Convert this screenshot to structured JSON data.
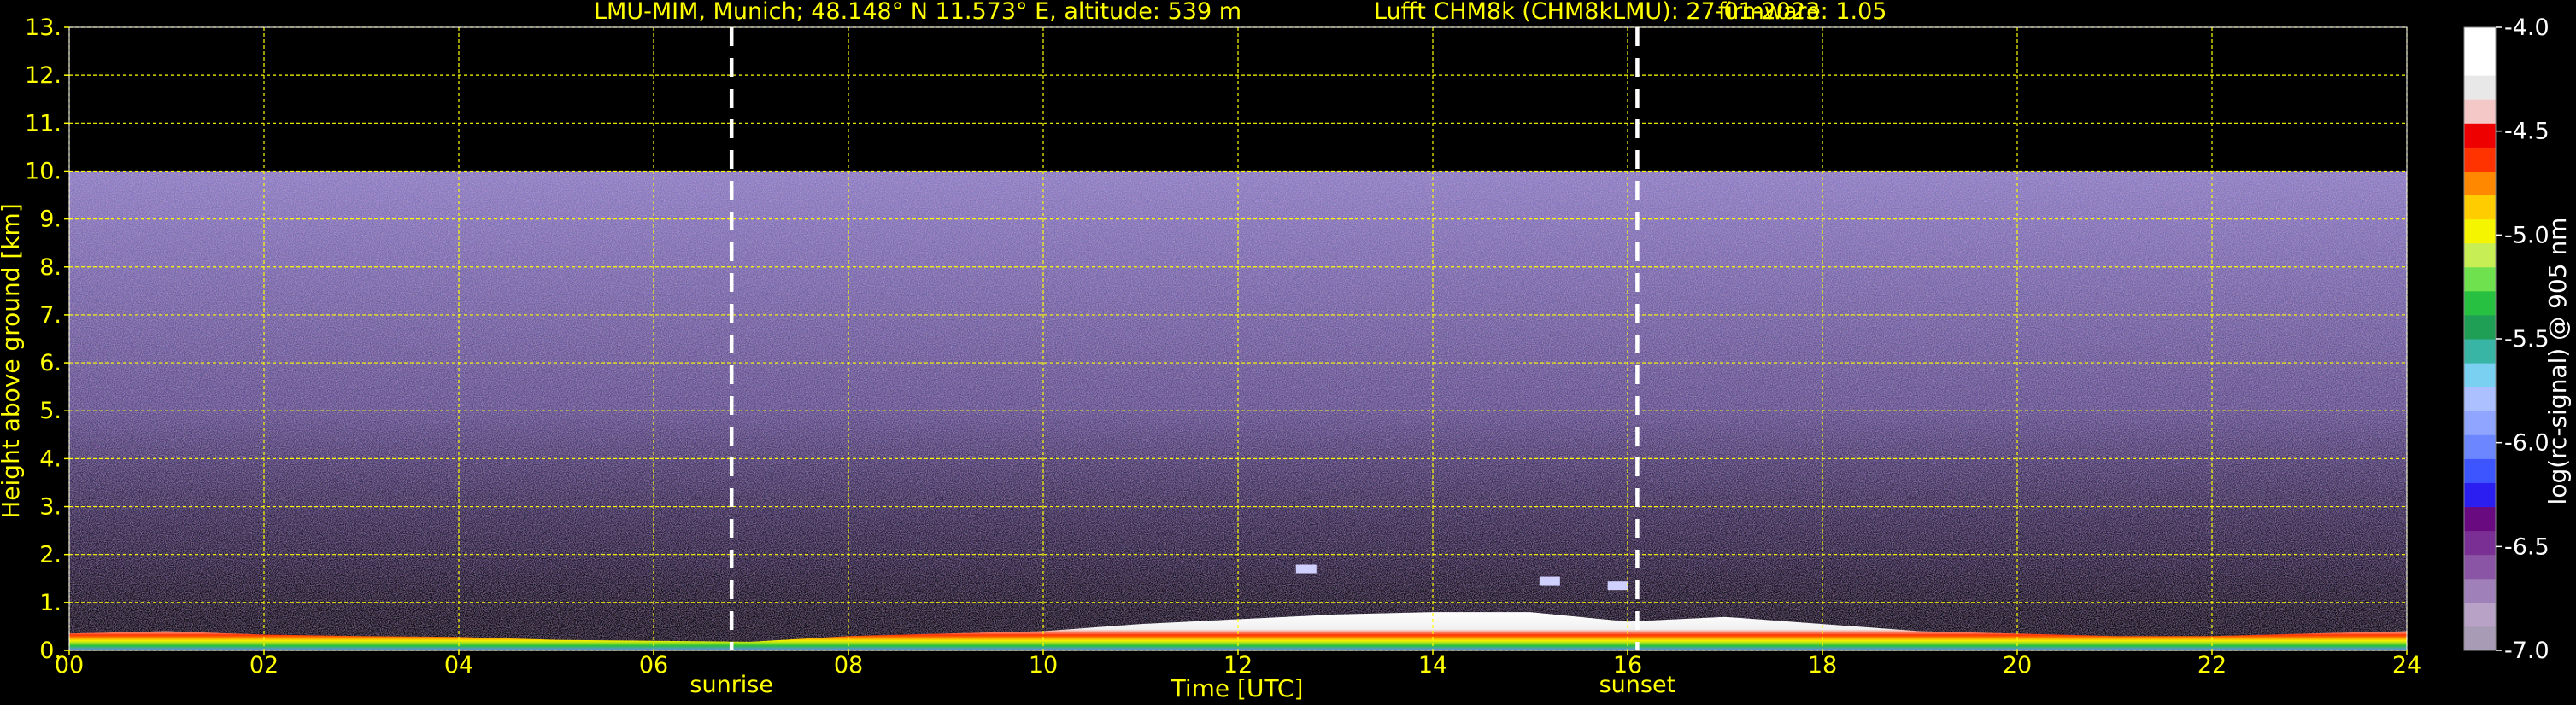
{
  "header": {
    "site": "LMU-MIM, Munich; 48.148° N 11.573° E, altitude: 539 m",
    "instrument": "Lufft CHM8k (CHM8kLMU): 27-01-2023",
    "firmware": "firmware: 1.05"
  },
  "chart_data": {
    "type": "heatmap",
    "xlabel": "Time [UTC]",
    "ylabel": "Height above ground [km]",
    "x_ticks": [
      "00",
      "02",
      "04",
      "06",
      "08",
      "10",
      "12",
      "14",
      "16",
      "18",
      "20",
      "22",
      "24"
    ],
    "y_ticks": [
      "0.",
      "1.",
      "2.",
      "3.",
      "4.",
      "5.",
      "6.",
      "7.",
      "8.",
      "9.",
      "10.",
      "11.",
      "12.",
      "13."
    ],
    "xlim": [
      0,
      24
    ],
    "ylim": [
      0,
      13
    ],
    "grid": true,
    "grid_color": "#ffff00",
    "text_color": "#ffff00",
    "background": "#000000",
    "signal_top_km": 10.0,
    "events": [
      {
        "label": "sunrise",
        "time_utc": 6.8
      },
      {
        "label": "sunset",
        "time_utc": 16.1
      }
    ],
    "colorbar": {
      "label": "log(rc-signal) @ 905 nm",
      "ticks": [
        "-4.0",
        "-4.5",
        "-5.0",
        "-5.5",
        "-6.0",
        "-6.5",
        "-7.0"
      ],
      "range": [
        -7.0,
        -4.0
      ],
      "colors": [
        "#a79bb6",
        "#b8a3c6",
        "#a080b8",
        "#8b55a5",
        "#7a2f95",
        "#6a0a80",
        "#2a1ff0",
        "#3d55ff",
        "#6b86ff",
        "#8fa5ff",
        "#acc0ff",
        "#7ad0f0",
        "#39b5a5",
        "#1f9e55",
        "#27c040",
        "#6fe04e",
        "#c8ee55",
        "#f5f500",
        "#ffcc00",
        "#ff8800",
        "#ff3300",
        "#ee0000",
        "#f5c8c8",
        "#e8e8e8",
        "#ffffff",
        "#ffffff"
      ]
    },
    "boundary_layer": [
      {
        "hour": 0.0,
        "height_km": 0.35
      },
      {
        "hour": 1.0,
        "height_km": 0.4
      },
      {
        "hour": 2.0,
        "height_km": 0.33
      },
      {
        "hour": 3.0,
        "height_km": 0.3
      },
      {
        "hour": 4.0,
        "height_km": 0.28
      },
      {
        "hour": 5.0,
        "height_km": 0.22
      },
      {
        "hour": 6.0,
        "height_km": 0.2
      },
      {
        "hour": 7.0,
        "height_km": 0.18
      },
      {
        "hour": 8.0,
        "height_km": 0.3
      },
      {
        "hour": 9.0,
        "height_km": 0.35
      },
      {
        "hour": 10.0,
        "height_km": 0.4
      },
      {
        "hour": 11.0,
        "height_km": 0.55
      },
      {
        "hour": 12.0,
        "height_km": 0.65
      },
      {
        "hour": 13.0,
        "height_km": 0.75
      },
      {
        "hour": 14.0,
        "height_km": 0.8
      },
      {
        "hour": 15.0,
        "height_km": 0.8
      },
      {
        "hour": 16.0,
        "height_km": 0.6
      },
      {
        "hour": 17.0,
        "height_km": 0.7
      },
      {
        "hour": 18.0,
        "height_km": 0.55
      },
      {
        "hour": 19.0,
        "height_km": 0.4
      },
      {
        "hour": 20.0,
        "height_km": 0.35
      },
      {
        "hour": 21.0,
        "height_km": 0.3
      },
      {
        "hour": 22.0,
        "height_km": 0.3
      },
      {
        "hour": 23.0,
        "height_km": 0.35
      },
      {
        "hour": 24.0,
        "height_km": 0.4
      }
    ],
    "elevated_layers": [
      {
        "hour": 15.2,
        "height_km": 1.45
      },
      {
        "hour": 15.9,
        "height_km": 1.35
      },
      {
        "hour": 12.7,
        "height_km": 1.7
      }
    ]
  }
}
